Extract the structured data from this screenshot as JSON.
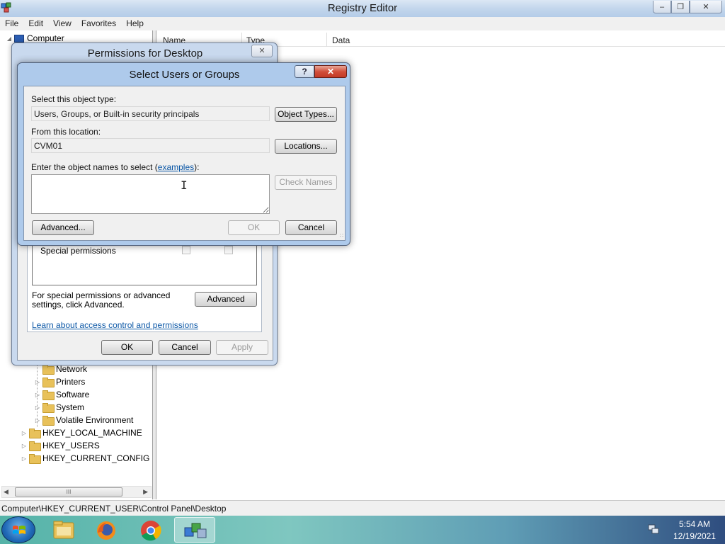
{
  "window": {
    "title": "Registry Editor"
  },
  "menu": [
    "File",
    "Edit",
    "View",
    "Favorites",
    "Help"
  ],
  "tree": {
    "root": "Computer",
    "desktop_children": [
      "Network",
      "Printers",
      "Software",
      "System",
      "Volatile Environment"
    ],
    "hives": [
      "HKEY_LOCAL_MACHINE",
      "HKEY_USERS",
      "HKEY_CURRENT_CONFIG"
    ]
  },
  "list": {
    "columns": [
      "Name",
      "Type",
      "Data"
    ]
  },
  "scrollbar": {
    "thumb_grip": "III"
  },
  "status": {
    "path": "Computer\\HKEY_CURRENT_USER\\Control Panel\\Desktop"
  },
  "permissions_dialog": {
    "title": "Permissions for Desktop",
    "special_permissions_label": "Special permissions",
    "advanced_note": "For special permissions or advanced settings, click Advanced.",
    "advanced_button": "Advanced",
    "learn_link": "Learn about access control and permissions",
    "ok": "OK",
    "cancel": "Cancel",
    "apply": "Apply"
  },
  "select_dialog": {
    "title": "Select Users or Groups",
    "help_button": "?",
    "object_type_label": "Select this object type:",
    "object_type_value": "Users, Groups, or Built-in security principals",
    "object_types_button": "Object Types...",
    "location_label": "From this location:",
    "location_value": "CVM01",
    "locations_button": "Locations...",
    "names_label": "Enter the object names to select (",
    "names_link": "examples",
    "names_label_end": "):",
    "check_names_button": "Check Names",
    "advanced_button": "Advanced...",
    "ok": "OK",
    "cancel": "Cancel"
  },
  "taskbar": {
    "apps": [
      "file-explorer",
      "firefox",
      "chrome",
      "registry-editor"
    ],
    "active_app": "registry-editor",
    "time": "5:54 AM",
    "date": "12/19/2021"
  },
  "colors": {
    "title_gradient": "#c3d6ec",
    "dialog_frame": "#aecaeb",
    "close_red": "#c23a26",
    "link_blue": "#0b57a6"
  }
}
